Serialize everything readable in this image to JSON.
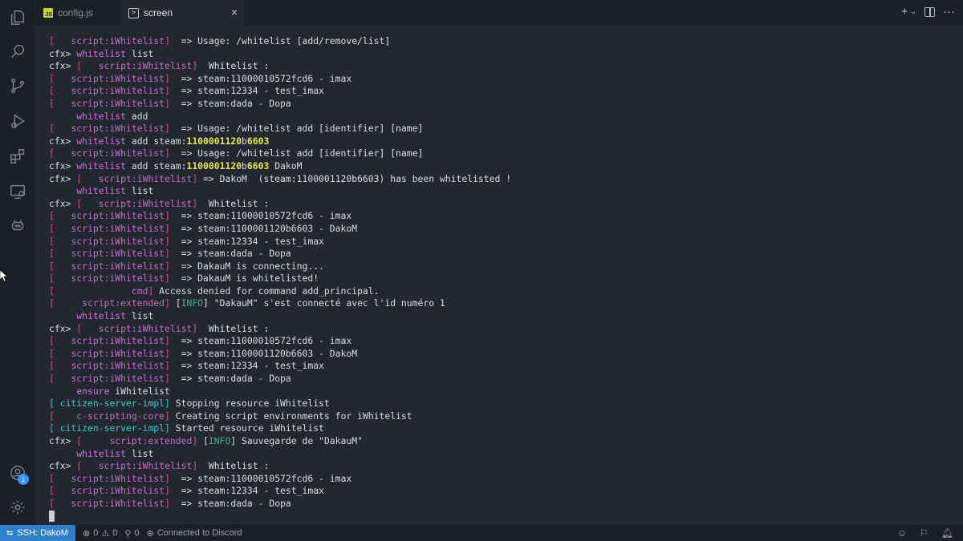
{
  "tabs": [
    {
      "label": "config.js",
      "icon": "js-file-icon",
      "active": false
    },
    {
      "label": "screen",
      "icon": "terminal-icon",
      "active": true
    }
  ],
  "tab_close": "×",
  "tab_actions": {
    "new": "+",
    "dropdown": "⌄",
    "more": "···"
  },
  "activity_bar": {
    "items": [
      "explorer-icon",
      "search-icon",
      "source-control-icon",
      "run-debug-icon",
      "extensions-icon",
      "remote-explorer-icon",
      "copilot-icon"
    ],
    "accounts_badge": "1"
  },
  "terminal": {
    "lines": [
      [
        [
          "br",
          "[   "
        ],
        [
          "sn",
          "script:iWhitelist"
        ],
        [
          "br",
          "]"
        ],
        [
          "t",
          "  => Usage: /whitelist [add/remove/list]"
        ]
      ],
      [
        [
          "t",
          "cfx> "
        ],
        [
          "cmd",
          "whitelist"
        ],
        [
          "t",
          " list"
        ]
      ],
      [
        [
          "t",
          "cfx> "
        ],
        [
          "br",
          "[   "
        ],
        [
          "sn",
          "script:iWhitelist"
        ],
        [
          "br",
          "]"
        ],
        [
          "t",
          "  Whitelist :"
        ]
      ],
      [
        [
          "br",
          "[   "
        ],
        [
          "sn",
          "script:iWhitelist"
        ],
        [
          "br",
          "]"
        ],
        [
          "t",
          "  => steam:11000010572fcd6 - imax"
        ]
      ],
      [
        [
          "br",
          "[   "
        ],
        [
          "sn",
          "script:iWhitelist"
        ],
        [
          "br",
          "]"
        ],
        [
          "t",
          "  => steam:12334 - test_imax"
        ]
      ],
      [
        [
          "br",
          "[   "
        ],
        [
          "sn",
          "script:iWhitelist"
        ],
        [
          "br",
          "]"
        ],
        [
          "t",
          "  => steam:dada - Dopa"
        ]
      ],
      [
        [
          "t",
          "     "
        ],
        [
          "cmd",
          "whitelist"
        ],
        [
          "t",
          " add"
        ]
      ],
      [
        [
          "br",
          "[   "
        ],
        [
          "sn",
          "script:iWhitelist"
        ],
        [
          "br",
          "]"
        ],
        [
          "t",
          "  => Usage: /whitelist add [identifier] [name]"
        ]
      ],
      [
        [
          "t",
          "cfx> "
        ],
        [
          "cmd",
          "whitelist"
        ],
        [
          "t",
          " add steam:"
        ],
        [
          "hl",
          "1100001120"
        ],
        [
          "t",
          "b"
        ],
        [
          "hl",
          "6603"
        ]
      ],
      [
        [
          "br",
          "[   "
        ],
        [
          "sn",
          "script:iWhitelist"
        ],
        [
          "br",
          "]"
        ],
        [
          "t",
          "  => Usage: /whitelist add [identifier] [name]"
        ]
      ],
      [
        [
          "t",
          "cfx> "
        ],
        [
          "cmd",
          "whitelist"
        ],
        [
          "t",
          " add steam:"
        ],
        [
          "hl",
          "1100001120"
        ],
        [
          "t",
          "b"
        ],
        [
          "hl",
          "6603"
        ],
        [
          "t",
          " DakoM"
        ]
      ],
      [
        [
          "t",
          "cfx> "
        ],
        [
          "br",
          "[   "
        ],
        [
          "sn",
          "script:iWhitelist"
        ],
        [
          "br",
          "]"
        ],
        [
          "t",
          " => DakoM  (steam:1100001120b6603) has been whitelisted !"
        ]
      ],
      [
        [
          "t",
          "     "
        ],
        [
          "cmd",
          "whitelist"
        ],
        [
          "t",
          " list"
        ]
      ],
      [
        [
          "t",
          "cfx> "
        ],
        [
          "br",
          "[   "
        ],
        [
          "sn",
          "script:iWhitelist"
        ],
        [
          "br",
          "]"
        ],
        [
          "t",
          "  Whitelist :"
        ]
      ],
      [
        [
          "br",
          "[   "
        ],
        [
          "sn",
          "script:iWhitelist"
        ],
        [
          "br",
          "]"
        ],
        [
          "t",
          "  => steam:11000010572fcd6 - imax"
        ]
      ],
      [
        [
          "br",
          "[   "
        ],
        [
          "sn",
          "script:iWhitelist"
        ],
        [
          "br",
          "]"
        ],
        [
          "t",
          "  => steam:1100001120b6603 - DakoM"
        ]
      ],
      [
        [
          "br",
          "[   "
        ],
        [
          "sn",
          "script:iWhitelist"
        ],
        [
          "br",
          "]"
        ],
        [
          "t",
          "  => steam:12334 - test_imax"
        ]
      ],
      [
        [
          "br",
          "[   "
        ],
        [
          "sn",
          "script:iWhitelist"
        ],
        [
          "br",
          "]"
        ],
        [
          "t",
          "  => steam:dada - Dopa"
        ]
      ],
      [
        [
          "br",
          "[   "
        ],
        [
          "sn",
          "script:iWhitelist"
        ],
        [
          "br",
          "]"
        ],
        [
          "t",
          "  => DakauM is connecting..."
        ]
      ],
      [
        [
          "br",
          "[   "
        ],
        [
          "sn",
          "script:iWhitelist"
        ],
        [
          "br",
          "]"
        ],
        [
          "t",
          "  => DakauM is whitelisted!"
        ]
      ],
      [
        [
          "br",
          "[              "
        ],
        [
          "sn",
          "cmd"
        ],
        [
          "br",
          "]"
        ],
        [
          "t",
          " Access denied for command add_principal."
        ]
      ],
      [
        [
          "br",
          "[     "
        ],
        [
          "sn",
          "script:extended"
        ],
        [
          "br",
          "]"
        ],
        [
          "t",
          " ["
        ],
        [
          "info",
          "INFO"
        ],
        [
          "t",
          "] \"DakauM\" s'est connecté avec l'id numéro 1"
        ]
      ],
      [
        [
          "t",
          "     "
        ],
        [
          "cmd",
          "whitelist"
        ],
        [
          "t",
          " list"
        ]
      ],
      [
        [
          "t",
          "cfx> "
        ],
        [
          "br",
          "[   "
        ],
        [
          "sn",
          "script:iWhitelist"
        ],
        [
          "br",
          "]"
        ],
        [
          "t",
          "  Whitelist :"
        ]
      ],
      [
        [
          "br",
          "[   "
        ],
        [
          "sn",
          "script:iWhitelist"
        ],
        [
          "br",
          "]"
        ],
        [
          "t",
          "  => steam:11000010572fcd6 - imax"
        ]
      ],
      [
        [
          "br",
          "[   "
        ],
        [
          "sn",
          "script:iWhitelist"
        ],
        [
          "br",
          "]"
        ],
        [
          "t",
          "  => steam:1100001120b6603 - DakoM"
        ]
      ],
      [
        [
          "br",
          "[   "
        ],
        [
          "sn",
          "script:iWhitelist"
        ],
        [
          "br",
          "]"
        ],
        [
          "t",
          "  => steam:12334 - test_imax"
        ]
      ],
      [
        [
          "br",
          "[   "
        ],
        [
          "sn",
          "script:iWhitelist"
        ],
        [
          "br",
          "]"
        ],
        [
          "t",
          "  => steam:dada - Dopa"
        ]
      ],
      [
        [
          "t",
          "     "
        ],
        [
          "cmd",
          "ensure"
        ],
        [
          "t",
          " iWhitelist"
        ]
      ],
      [
        [
          "cy-br",
          "[ "
        ],
        [
          "cy",
          "citizen-server-impl"
        ],
        [
          "cy-br",
          "]"
        ],
        [
          "t",
          " Stopping resource iWhitelist"
        ]
      ],
      [
        [
          "br",
          "[    "
        ],
        [
          "sn",
          "c-scripting-core"
        ],
        [
          "br",
          "]"
        ],
        [
          "t",
          " Creating script environments for iWhitelist"
        ]
      ],
      [
        [
          "cy-br",
          "[ "
        ],
        [
          "cy",
          "citizen-server-impl"
        ],
        [
          "cy-br",
          "]"
        ],
        [
          "t",
          " Started resource iWhitelist"
        ]
      ],
      [
        [
          "t",
          "cfx> "
        ],
        [
          "br",
          "[     "
        ],
        [
          "sn",
          "script:extended"
        ],
        [
          "br",
          "]"
        ],
        [
          "t",
          " ["
        ],
        [
          "info",
          "INFO"
        ],
        [
          "t",
          "] Sauvegarde de \"DakauM\""
        ]
      ],
      [
        [
          "t",
          "     "
        ],
        [
          "cmd",
          "whitelist"
        ],
        [
          "t",
          " list"
        ]
      ],
      [
        [
          "t",
          "cfx> "
        ],
        [
          "br",
          "[   "
        ],
        [
          "sn",
          "script:iWhitelist"
        ],
        [
          "br",
          "]"
        ],
        [
          "t",
          "  Whitelist :"
        ]
      ],
      [
        [
          "br",
          "[   "
        ],
        [
          "sn",
          "script:iWhitelist"
        ],
        [
          "br",
          "]"
        ],
        [
          "t",
          "  => steam:11000010572fcd6 - imax"
        ]
      ],
      [
        [
          "br",
          "[   "
        ],
        [
          "sn",
          "script:iWhitelist"
        ],
        [
          "br",
          "]"
        ],
        [
          "t",
          "  => steam:12334 - test_imax"
        ]
      ],
      [
        [
          "br",
          "[   "
        ],
        [
          "sn",
          "script:iWhitelist"
        ],
        [
          "br",
          "]"
        ],
        [
          "t",
          "  => steam:dada - Dopa"
        ]
      ]
    ]
  },
  "status_bar": {
    "remote_label": "SSH: DakoM",
    "errors": "0",
    "warnings": "0",
    "ports": "0",
    "discord": "Connected to Discord"
  },
  "colors": {
    "accent": "#2f80c8",
    "bracket": "#e0487a",
    "source_name": "#c46cc9",
    "cyan": "#3cc9c9",
    "highlight": "#e8e84a",
    "info": "#3fb28f"
  }
}
